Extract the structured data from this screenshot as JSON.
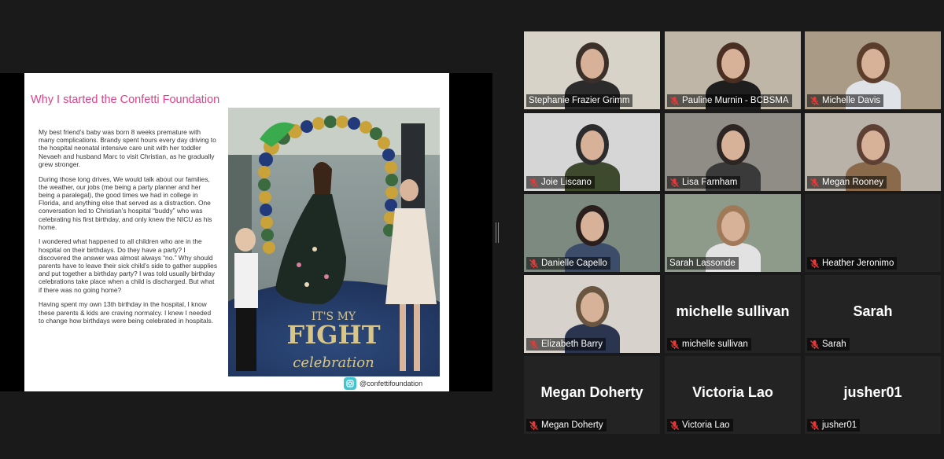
{
  "slide": {
    "title": "Why I started the Confetti Foundation",
    "paragraphs": [
      "My best friend’s baby was born 8 weeks premature with many complications. Brandy spent hours every day driving to the hospital neonatal intensive care unit with her toddler Nevaeh and husband Marc to visit Christian, as he gradually grew stronger.",
      "During those long drives, We would talk about our families, the weather, our jobs (me being a party planner and her being a paralegal), the good times we had in college in Florida, and anything else that served as a distraction. One conversation led to Christian’s hospital “buddy” who was celebrating his first birthday, and only knew the NICU as his home.",
      "I wondered what happened to all children who are in the hospital on their birthdays. Do they have a party? I discovered the answer was almost always “no.” Why should parents have to leave their sick child’s side to gather supplies and put together a birthday party? I was told usually birthday celebrations take place when a child is discharged. But what if there was no going home?",
      "Having spent my own 13th birthday in the hospital, I know these parents & kids are craving normalcy. I knew I needed to change how birthdays were being celebrated in hospitals."
    ],
    "photo_banner_text": "IT'S MY FIGHT celebration",
    "footer_handle": "@confettifoundation",
    "footer_icon": "instagram-icon"
  },
  "participants": [
    {
      "name": "Stephanie Frazier Grimm",
      "muted": false,
      "video": true,
      "active": true
    },
    {
      "name": "Pauline Murnin - BCBSMA",
      "muted": true,
      "video": true
    },
    {
      "name": "Michelle Davis",
      "muted": true,
      "video": true
    },
    {
      "name": "Joie Liscano",
      "muted": true,
      "video": true
    },
    {
      "name": "Lisa Farnham",
      "muted": true,
      "video": true
    },
    {
      "name": "Megan Rooney",
      "muted": true,
      "video": true
    },
    {
      "name": "Danielle Capello",
      "muted": true,
      "video": true
    },
    {
      "name": "Sarah Lassonde",
      "muted": false,
      "video": true
    },
    {
      "name": "Heather Jeronimo",
      "muted": true,
      "video": false,
      "display": ""
    },
    {
      "name": "Elizabeth Barry",
      "muted": true,
      "video": true
    },
    {
      "name": "michelle sullivan",
      "muted": true,
      "video": false,
      "display": "michelle sullivan"
    },
    {
      "name": "Sarah",
      "muted": true,
      "video": false,
      "display": "Sarah"
    },
    {
      "name": "Megan Doherty",
      "muted": true,
      "video": false,
      "display": "Megan Doherty"
    },
    {
      "name": "Victoria Lao",
      "muted": true,
      "video": false,
      "display": "Victoria Lao"
    },
    {
      "name": "jusher01",
      "muted": true,
      "video": false,
      "display": "jusher01"
    }
  ],
  "colors": {
    "background": "#1a1a1a",
    "tile": "#232323",
    "active_speaker": "#b2d36a",
    "mute_icon": "#e03a3a",
    "slide_title": "#e0418c"
  }
}
